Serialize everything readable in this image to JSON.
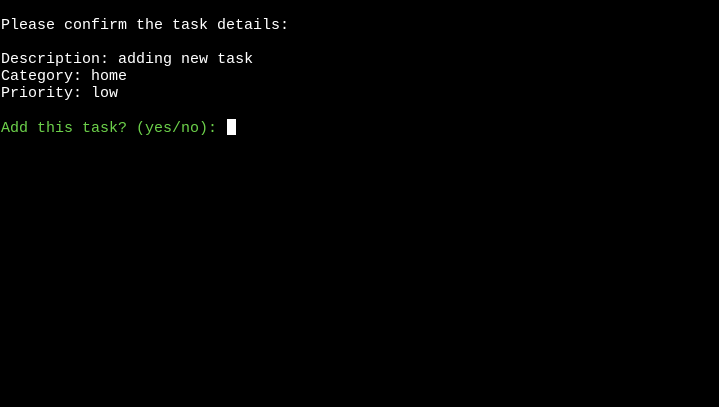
{
  "terminal": {
    "header": "Please confirm the task details:",
    "details": [
      {
        "label": "Description",
        "value": "adding new task"
      },
      {
        "label": "Category",
        "value": "home"
      },
      {
        "label": "Priority",
        "value": "low"
      }
    ],
    "prompt": "Add this task? (yes/no): ",
    "input_value": ""
  },
  "colors": {
    "background": "#000000",
    "text": "#ffffff",
    "prompt": "#6cd04a",
    "cursor": "#ffffff"
  }
}
